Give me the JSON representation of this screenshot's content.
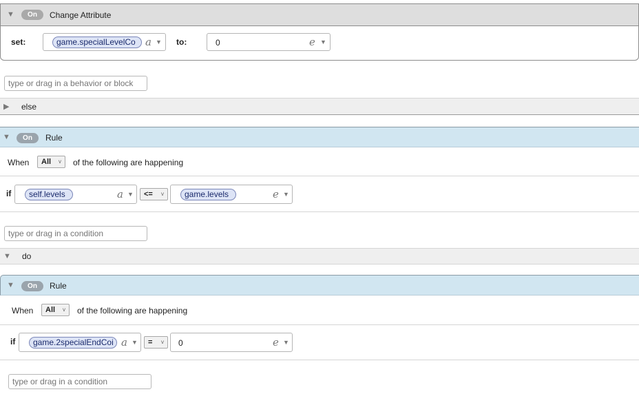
{
  "block1": {
    "toggle": "On",
    "title": "Change Attribute",
    "set_label": "set:",
    "set_value": "game.specialLevelCo",
    "to_label": "to:",
    "to_value": "0",
    "type_attr": "a",
    "type_expr": "e"
  },
  "behavior_input": {
    "placeholder": "type or drag in a behavior or block"
  },
  "else_label": "else",
  "rule1": {
    "toggle": "On",
    "title": "Rule",
    "when": "When",
    "mode": "All",
    "following": "of the following are happening",
    "if_label": "if",
    "left": "self.levels",
    "operator": "<=",
    "right": "game.levels",
    "type_attr": "a",
    "type_expr": "e"
  },
  "condition_input_1": {
    "placeholder": "type or drag in a condition"
  },
  "do_label": "do",
  "rule2": {
    "toggle": "On",
    "title": "Rule",
    "when": "When",
    "mode": "All",
    "following": "of the following are happening",
    "if_label": "if",
    "left": "game.2specialEndCoi",
    "operator": "=",
    "right": "0",
    "type_attr": "a",
    "type_expr": "e"
  },
  "condition_input_2": {
    "placeholder": "type or drag in a condition"
  },
  "colors": {
    "grey_header": "#dedede",
    "rule_header": "#d1e6f1",
    "token_fill": "#dde4f6",
    "toggle_pill": "#9aa4ac"
  }
}
